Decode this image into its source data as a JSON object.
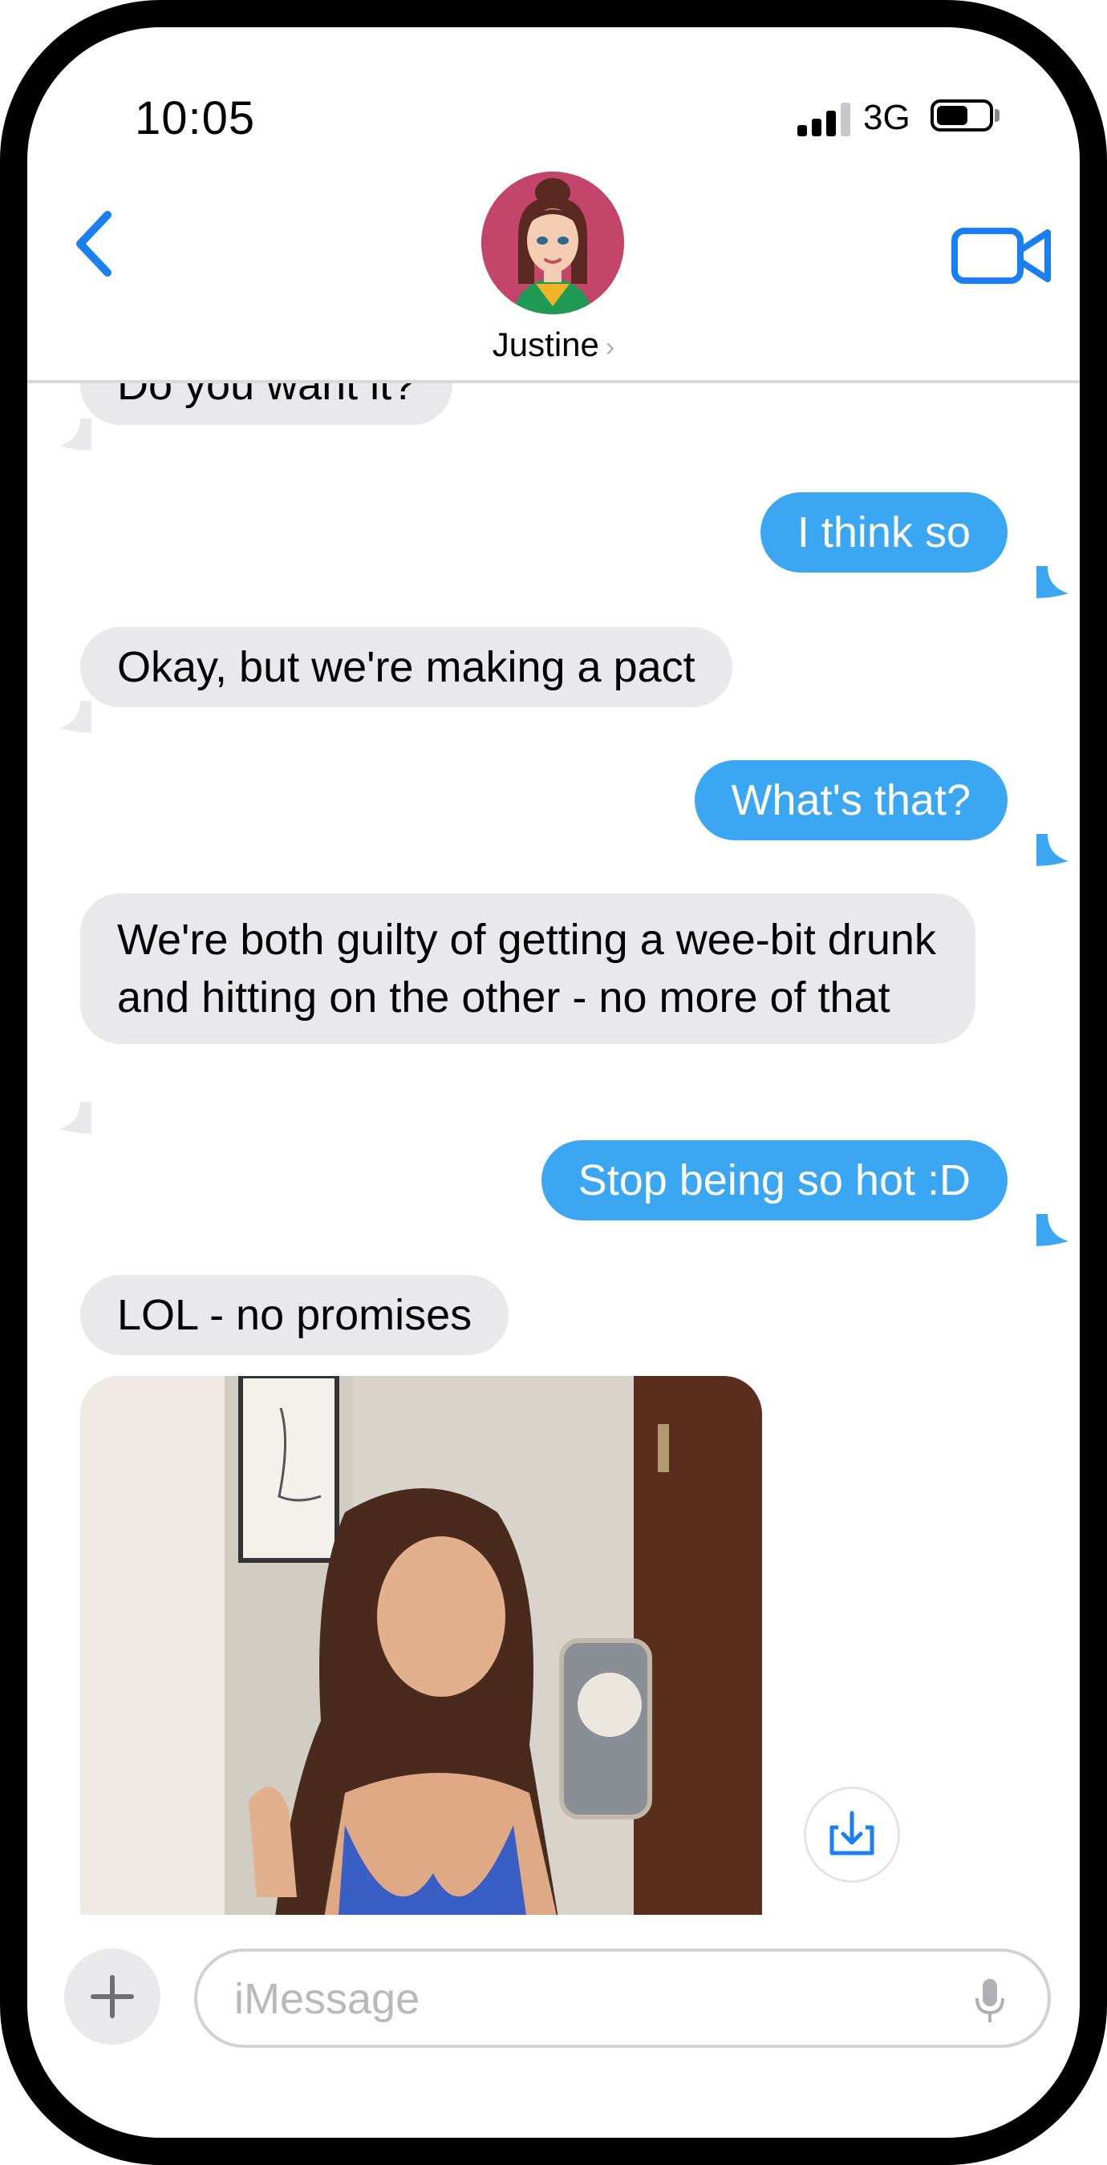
{
  "status_bar": {
    "time": "10:05",
    "network": "3G",
    "signal_bars_filled": 3,
    "signal_bars_total": 4
  },
  "header": {
    "contact_name": "Justine",
    "back_icon": "chevron-left-icon",
    "video_icon": "video-camera-icon"
  },
  "colors": {
    "accent": "#1a7ff0",
    "outgoing_bubble": "#3ba7f3",
    "incoming_bubble": "#e9e9eb"
  },
  "messages": [
    {
      "direction": "incoming",
      "text": "Do you want it?"
    },
    {
      "direction": "outgoing",
      "text": "I think so"
    },
    {
      "direction": "incoming",
      "text": "Okay, but we're making a pact"
    },
    {
      "direction": "outgoing",
      "text": "What's that?"
    },
    {
      "direction": "incoming",
      "text": "We're both guilty of getting a wee-bit drunk and hitting on the other - no more of that"
    },
    {
      "direction": "outgoing",
      "text": "Stop being so hot :D"
    },
    {
      "direction": "incoming",
      "text": "LOL - no promises"
    }
  ],
  "attachment": {
    "type": "photo",
    "download_icon": "download-icon"
  },
  "composer": {
    "placeholder": "iMessage",
    "plus_icon": "plus-icon",
    "mic_icon": "microphone-icon"
  }
}
